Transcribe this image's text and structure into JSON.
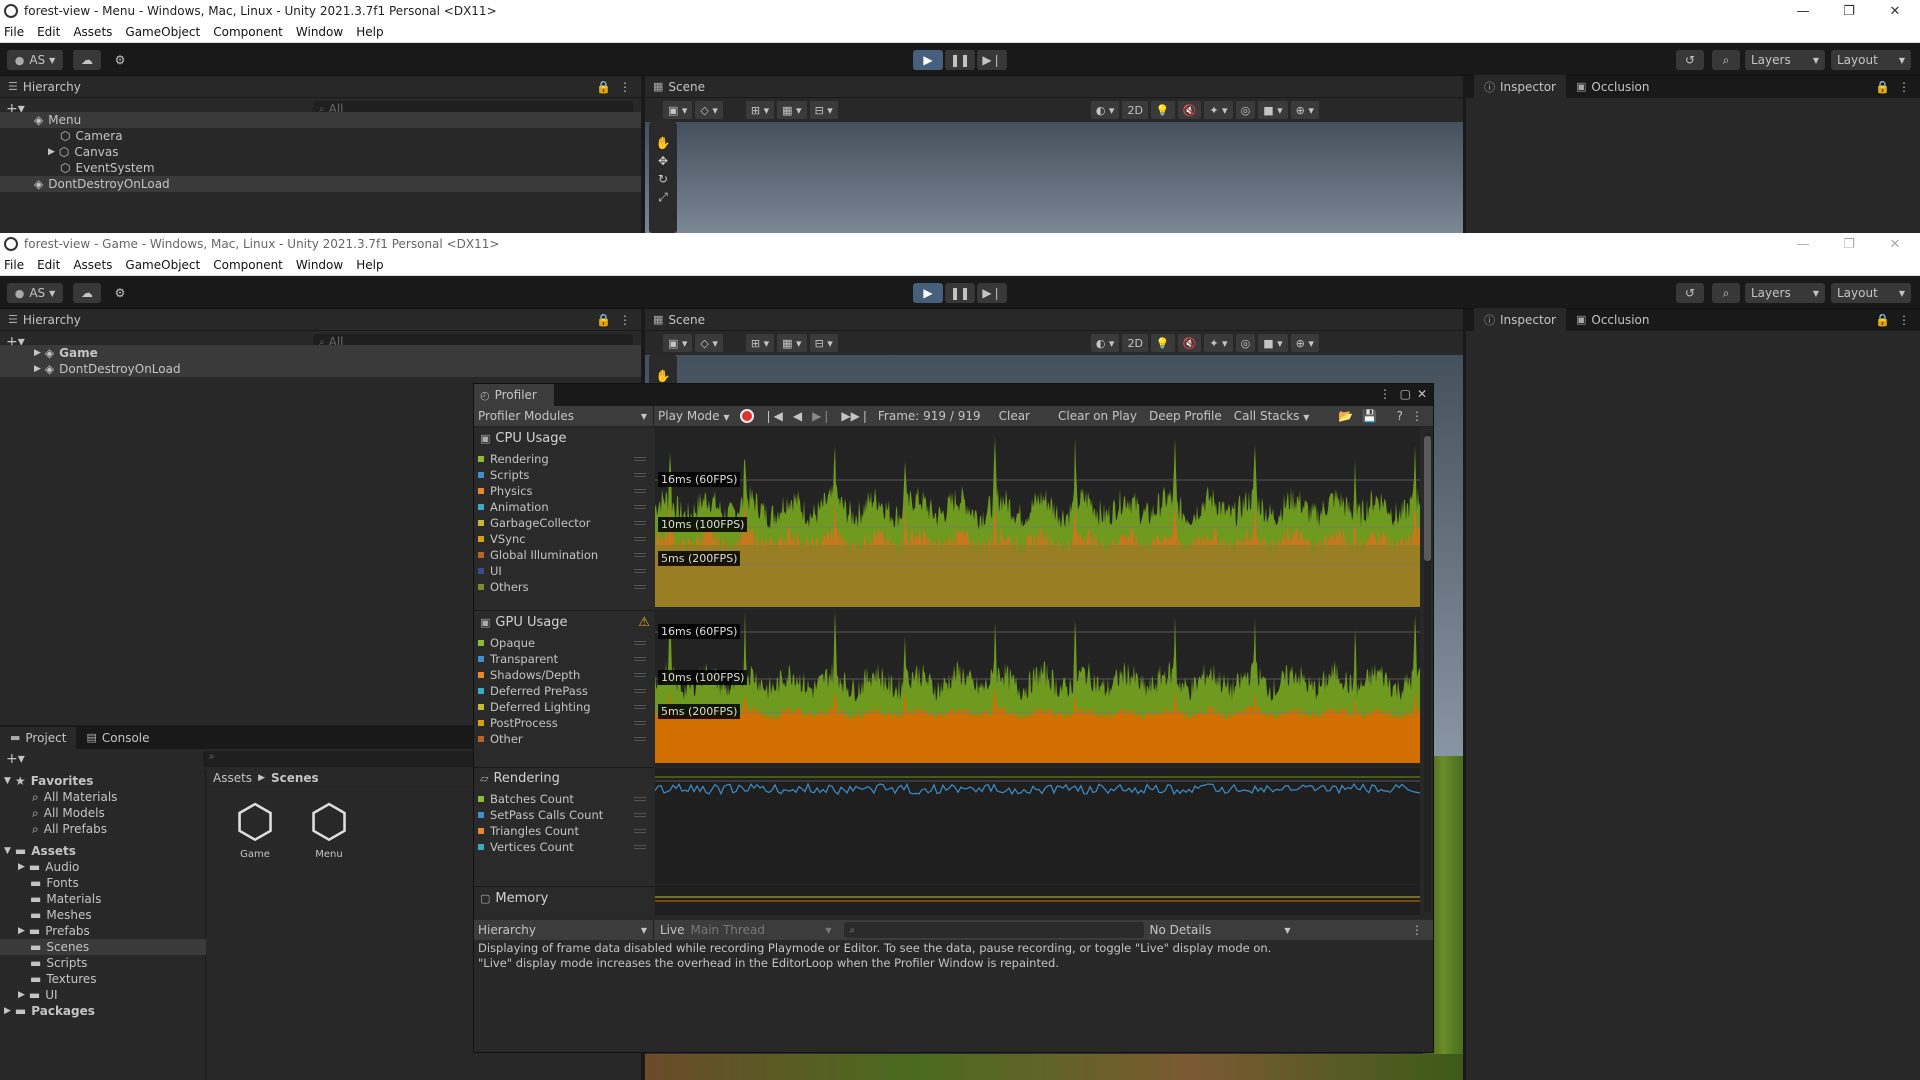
{
  "window1": {
    "title": "forest-view - Menu - Windows, Mac, Linux - Unity 2021.3.7f1 Personal <DX11>",
    "menu": [
      "File",
      "Edit",
      "Assets",
      "GameObject",
      "Component",
      "Window",
      "Help"
    ],
    "account": "AS",
    "layers": "Layers",
    "layout": "Layout",
    "hierarchy_tab": "Hierarchy",
    "search_placeholder": "All",
    "hierarchy": {
      "root": "Menu",
      "items": [
        "Camera",
        "Canvas",
        "EventSystem"
      ],
      "dont_destroy": "DontDestroyOnLoad"
    },
    "scene_tab": "Scene",
    "inspector_tab": "Inspector",
    "occlusion_tab": "Occlusion",
    "btn_2d": "2D"
  },
  "window2": {
    "title": "forest-view - Game - Windows, Mac, Linux - Unity 2021.3.7f1 Personal <DX11>",
    "menu": [
      "File",
      "Edit",
      "Assets",
      "GameObject",
      "Component",
      "Window",
      "Help"
    ],
    "account": "AS",
    "layers": "Layers",
    "layout": "Layout",
    "hierarchy_tab": "Hierarchy",
    "search_placeholder": "All",
    "hierarchy": {
      "root": "Game",
      "dont_destroy": "DontDestroyOnLoad"
    },
    "scene_tab": "Scene",
    "inspector_tab": "Inspector",
    "occlusion_tab": "Occlusion",
    "btn_2d": "2D",
    "project_tab": "Project",
    "console_tab": "Console",
    "favorites": {
      "label": "Favorites",
      "items": [
        "All Materials",
        "All Models",
        "All Prefabs"
      ]
    },
    "assets": {
      "label": "Assets",
      "items": [
        "Audio",
        "Fonts",
        "Materials",
        "Meshes",
        "Prefabs",
        "Scenes",
        "Scripts",
        "Textures",
        "UI"
      ]
    },
    "packages": "Packages",
    "breadcrumb": {
      "root": "Assets",
      "current": "Scenes"
    },
    "scene_files": [
      "Game",
      "Menu"
    ]
  },
  "profiler": {
    "tab": "Profiler",
    "modules_dropdown": "Profiler Modules",
    "play_mode": "Play Mode",
    "frame": "Frame: 919 / 919",
    "clear": "Clear",
    "clear_on_play": "Clear on Play",
    "deep_profile": "Deep Profile",
    "call_stacks": "Call Stacks",
    "cpu": {
      "title": "CPU Usage",
      "items": [
        {
          "label": "Rendering",
          "color": "#8fb833"
        },
        {
          "label": "Scripts",
          "color": "#3d8ec9"
        },
        {
          "label": "Physics",
          "color": "#e6882e"
        },
        {
          "label": "Animation",
          "color": "#3daac4"
        },
        {
          "label": "GarbageCollector",
          "color": "#c4b83c"
        },
        {
          "label": "VSync",
          "color": "#d4a017"
        },
        {
          "label": "Global Illumination",
          "color": "#b5632a"
        },
        {
          "label": "UI",
          "color": "#3a4a8c"
        },
        {
          "label": "Others",
          "color": "#7a8c2e"
        }
      ]
    },
    "gpu": {
      "title": "GPU Usage",
      "items": [
        {
          "label": "Opaque",
          "color": "#8fb833"
        },
        {
          "label": "Transparent",
          "color": "#3d8ec9"
        },
        {
          "label": "Shadows/Depth",
          "color": "#e6882e"
        },
        {
          "label": "Deferred PrePass",
          "color": "#3daac4"
        },
        {
          "label": "Deferred Lighting",
          "color": "#c4b83c"
        },
        {
          "label": "PostProcess",
          "color": "#d4a017"
        },
        {
          "label": "Other",
          "color": "#b5632a"
        }
      ]
    },
    "rendering": {
      "title": "Rendering",
      "items": [
        {
          "label": "Batches Count",
          "color": "#8fb833"
        },
        {
          "label": "SetPass Calls Count",
          "color": "#3d8ec9"
        },
        {
          "label": "Triangles Count",
          "color": "#e6882e"
        },
        {
          "label": "Vertices Count",
          "color": "#3daac4"
        }
      ]
    },
    "memory": {
      "title": "Memory"
    },
    "fps_labels": [
      "16ms (60FPS)",
      "10ms (100FPS)",
      "5ms (200FPS)"
    ],
    "bottom": {
      "view": "Hierarchy",
      "live": "Live",
      "thread": "Main Thread",
      "details": "No Details"
    },
    "message_line1": "Displaying of frame data disabled while recording Playmode or Editor. To see the data, pause recording, or toggle \"Live\" display mode on.",
    "message_line2": "\"Live\" display mode increases the overhead in the EditorLoop when the Profiler Window is repainted."
  }
}
